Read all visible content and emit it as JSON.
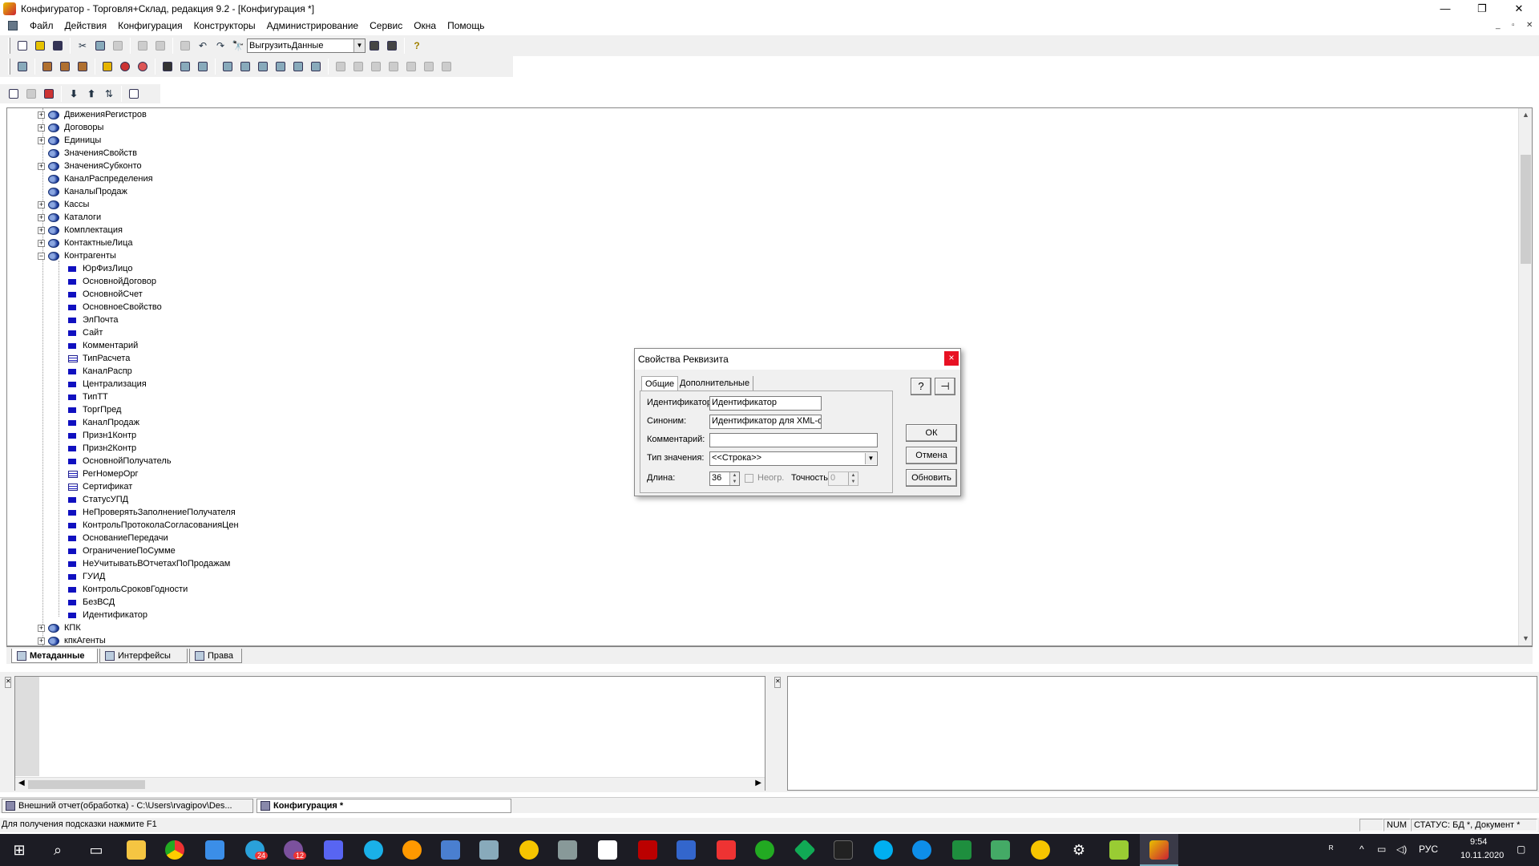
{
  "window": {
    "title": "Конфигуратор - Торговля+Склад, редакция 9.2 - [Конфигурация *]",
    "minimize": "—",
    "restore": "❐",
    "close": "✕"
  },
  "menu": [
    "Файл",
    "Действия",
    "Конфигурация",
    "Конструкторы",
    "Администрирование",
    "Сервис",
    "Окна",
    "Помощь"
  ],
  "mdi_controls": {
    "minimize": "_",
    "restore": "▫",
    "close": "✕"
  },
  "toolbar": {
    "search_value": "ВыгрузитьДанные",
    "help_glyph": "?"
  },
  "tree": {
    "top_nodes": [
      {
        "label": "ДвиженияРегистров",
        "expandable": true
      },
      {
        "label": "Договоры",
        "expandable": true
      },
      {
        "label": "Единицы",
        "expandable": true
      },
      {
        "label": "ЗначенияСвойств",
        "expandable": false
      },
      {
        "label": "ЗначенияСубконто",
        "expandable": true
      },
      {
        "label": "КаналРаспределения",
        "expandable": false
      },
      {
        "label": "КаналыПродаж",
        "expandable": false
      },
      {
        "label": "Кассы",
        "expandable": true
      },
      {
        "label": "Каталоги",
        "expandable": true
      },
      {
        "label": "Комплектация",
        "expandable": true
      },
      {
        "label": "КонтактныеЛица",
        "expandable": true
      },
      {
        "label": "Контрагенты",
        "expandable": true,
        "expanded": true
      }
    ],
    "children": [
      {
        "label": "ЮрФизЛицо",
        "kind": "attr"
      },
      {
        "label": "ОсновнойДоговор",
        "kind": "attr"
      },
      {
        "label": "ОсновнойСчет",
        "kind": "attr"
      },
      {
        "label": "ОсновноеСвойство",
        "kind": "attr"
      },
      {
        "label": "ЭлПочта",
        "kind": "attr"
      },
      {
        "label": "Сайт",
        "kind": "attr"
      },
      {
        "label": "Комментарий",
        "kind": "attr"
      },
      {
        "label": "ТипРасчета",
        "kind": "table"
      },
      {
        "label": "КаналРаспр",
        "kind": "attr"
      },
      {
        "label": "Централизация",
        "kind": "attr"
      },
      {
        "label": "ТипТТ",
        "kind": "attr"
      },
      {
        "label": "ТоргПред",
        "kind": "attr"
      },
      {
        "label": "КаналПродаж",
        "kind": "attr"
      },
      {
        "label": "Призн1Контр",
        "kind": "attr"
      },
      {
        "label": "Призн2Контр",
        "kind": "attr"
      },
      {
        "label": "ОсновнойПолучатель",
        "kind": "attr"
      },
      {
        "label": "РегНомерОрг",
        "kind": "table"
      },
      {
        "label": "Сертификат",
        "kind": "table"
      },
      {
        "label": "СтатусУПД",
        "kind": "attr"
      },
      {
        "label": "НеПроверятьЗаполнениеПолучателя",
        "kind": "attr"
      },
      {
        "label": "КонтрольПротоколаСогласованияЦен",
        "kind": "attr"
      },
      {
        "label": "ОснованиеПередачи",
        "kind": "attr"
      },
      {
        "label": "ОграничениеПоСумме",
        "kind": "attr"
      },
      {
        "label": "НеУчитыватьВОтчетахПоПродажам",
        "kind": "attr"
      },
      {
        "label": "ГУИД",
        "kind": "attr"
      },
      {
        "label": "КонтрольСроковГодности",
        "kind": "attr"
      },
      {
        "label": "БезВСД",
        "kind": "attr"
      },
      {
        "label": "Идентификатор",
        "kind": "attr"
      }
    ],
    "bottom_nodes": [
      {
        "label": "КПК",
        "expandable": true
      },
      {
        "label": "кпкАгенты",
        "expandable": true
      }
    ]
  },
  "bottom_tabs": [
    "Метаданные",
    "Интерфейсы",
    "Права"
  ],
  "dialog": {
    "title": "Свойства Реквизита",
    "close": "×",
    "tabs": [
      "Общие",
      "Дополнительные"
    ],
    "fields": {
      "identifier_label": "Идентификатор:",
      "identifier_value": "Идентификатор",
      "synonym_label": "Синоним:",
      "synonym_value": "Идентификатор для XML-о",
      "comment_label": "Комментарий:",
      "comment_value": "",
      "type_label": "Тип значения:",
      "type_value": "<<Строка>>",
      "length_label": "Длина:",
      "length_value": "36",
      "unlimited_label": "Неогр.",
      "precision_label": "Точность:",
      "precision_value": "0"
    },
    "buttons": {
      "ok": "ОК",
      "cancel": "Отмена",
      "refresh": "Обновить",
      "help": "?",
      "pin": "⊣"
    }
  },
  "window_tabs": [
    {
      "label": "Внешний отчет(обработка) - C:\\Users\\rvagipov\\Des..."
    },
    {
      "label": "Конфигурация *"
    }
  ],
  "status": {
    "hint": "Для получения подсказки нажмите F1",
    "num": "NUM",
    "state": "СТАТУС: БД *, Документ *"
  },
  "taskbar": {
    "lang": "РУС",
    "time": "9:54",
    "date": "10.11.2020",
    "badge_telegram": "24",
    "badge_viber": "12"
  }
}
